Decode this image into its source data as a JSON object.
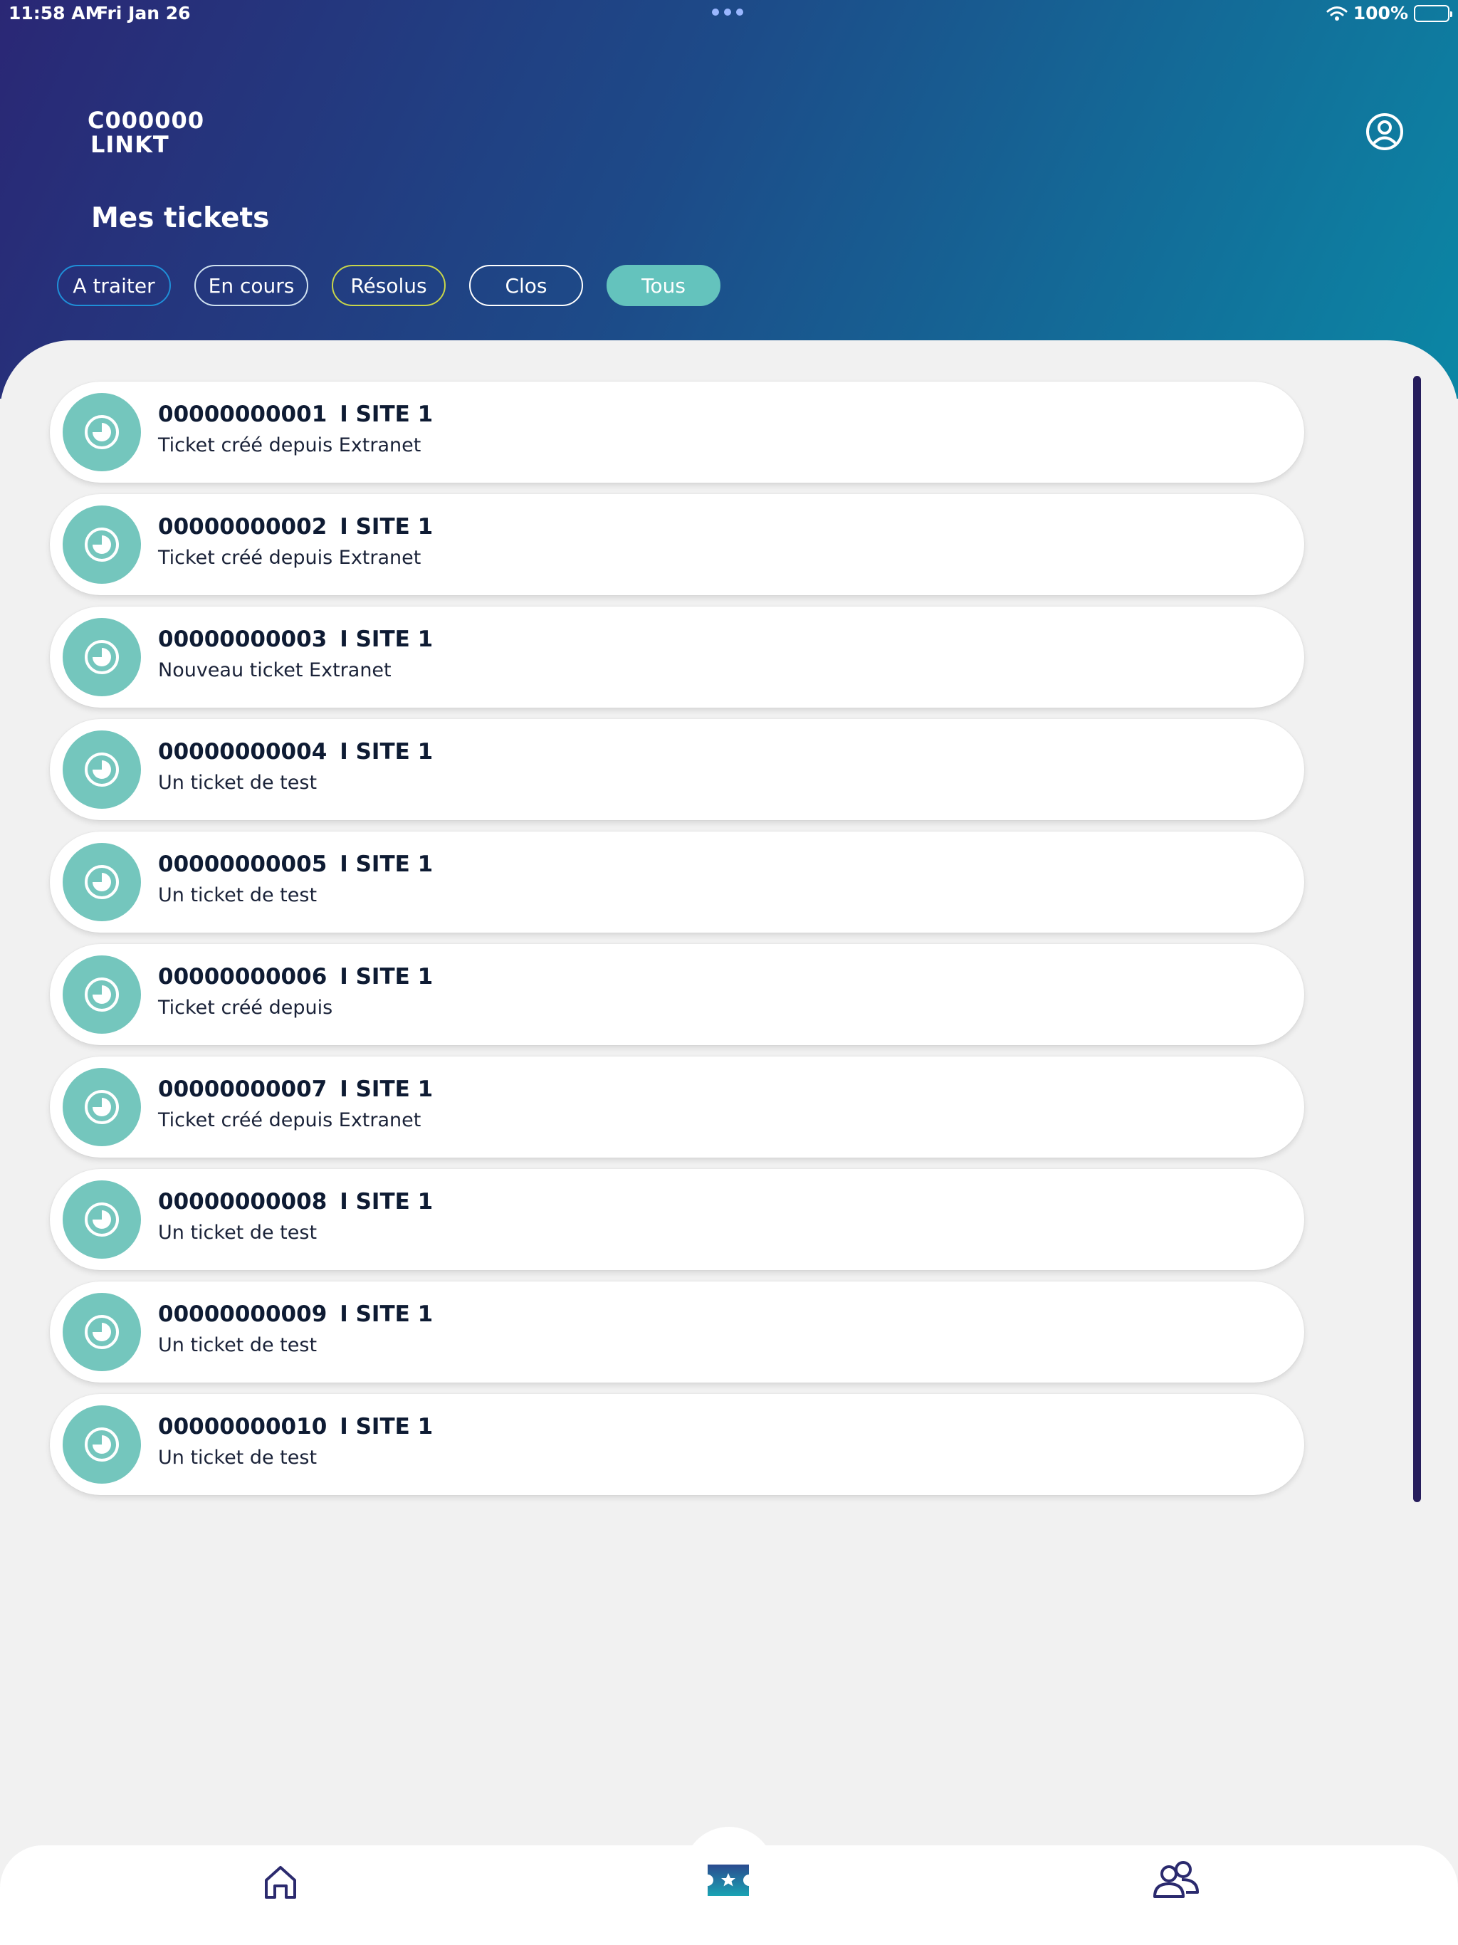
{
  "status_bar": {
    "time": "11:58 AM",
    "date": "Fri Jan 26",
    "battery": "100%"
  },
  "header": {
    "client_code": "C000000",
    "client_name": "LINKT",
    "title": "Mes tickets"
  },
  "filters": [
    {
      "label": "A traiter",
      "selected": false
    },
    {
      "label": "En cours",
      "selected": false
    },
    {
      "label": "Résolus",
      "selected": false
    },
    {
      "label": "Clos",
      "selected": false
    },
    {
      "label": "Tous",
      "selected": true
    }
  ],
  "tickets": [
    {
      "number": "00000000001",
      "site": "I SITE 1",
      "description": "Ticket créé depuis Extranet"
    },
    {
      "number": "00000000002",
      "site": "I SITE 1",
      "description": "Ticket créé depuis Extranet"
    },
    {
      "number": "00000000003",
      "site": "I SITE 1",
      "description": "Nouveau ticket Extranet"
    },
    {
      "number": "00000000004",
      "site": "I SITE 1",
      "description": "Un ticket de test"
    },
    {
      "number": "00000000005",
      "site": "I SITE 1",
      "description": "Un ticket de test"
    },
    {
      "number": "00000000006",
      "site": "I SITE 1",
      "description": "Ticket créé depuis"
    },
    {
      "number": "00000000007",
      "site": "I SITE 1",
      "description": "Ticket créé depuis Extranet"
    },
    {
      "number": "00000000008",
      "site": "I SITE 1",
      "description": "Un ticket de test"
    },
    {
      "number": "00000000009",
      "site": "I SITE 1",
      "description": "Un ticket de test"
    },
    {
      "number": "00000000010",
      "site": "I SITE 1",
      "description": "Un ticket de test"
    }
  ],
  "icons": {
    "ticket_status": "clock-icon",
    "profile": "user-circle-icon",
    "tab_home": "home-icon",
    "tab_tickets": "ticket-icon",
    "tab_users": "users-icon"
  },
  "colors": {
    "accent": "#64c3bd",
    "ticket_icon_bg": "#74c6bd",
    "header_gradient_start": "#2a2775",
    "header_gradient_end": "#0b87a5",
    "scrollbar": "#261d5c"
  }
}
